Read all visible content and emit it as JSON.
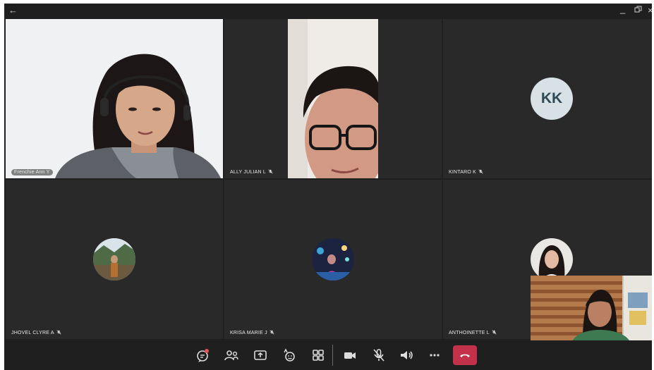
{
  "window": {
    "back_icon": "arrow-left-icon",
    "minimize_icon": "minimize-icon",
    "popout_icon": "popout-icon",
    "close_icon": "close-icon"
  },
  "participants": [
    {
      "name": "Frenchie Ann Y",
      "video": true
    },
    {
      "name": "ALLY JULIAN L",
      "muted": true,
      "video": true
    },
    {
      "name": "KINTARO K",
      "muted": true,
      "initials": "KK"
    },
    {
      "name": "JHOVEL CLYRE A",
      "muted": true,
      "avatar": "photo"
    },
    {
      "name": "KRISA MARIE J",
      "muted": true,
      "avatar": "photo"
    },
    {
      "name": "ANTHOINETTE L",
      "muted": true,
      "avatar": "photo"
    }
  ],
  "controls": [
    {
      "name": "chat-button",
      "icon": "chat-icon"
    },
    {
      "name": "participants-button",
      "icon": "people-icon"
    },
    {
      "name": "share-button",
      "icon": "share-screen-icon"
    },
    {
      "name": "reactions-button",
      "icon": "reaction-icon"
    },
    {
      "name": "apps-button",
      "icon": "grid-icon"
    },
    {
      "name": "camera-button",
      "icon": "camera-icon"
    },
    {
      "name": "mic-button",
      "icon": "mic-off-icon"
    },
    {
      "name": "speaker-button",
      "icon": "speaker-icon"
    },
    {
      "name": "more-button",
      "icon": "more-icon"
    },
    {
      "name": "leave-button",
      "icon": "hang-up-icon"
    }
  ],
  "colors": {
    "background": "#1f1f1f",
    "tile": "#292929",
    "leave": "#c4314b",
    "initials_avatar": "#d8e2e6",
    "initials_text": "#2e4a57"
  }
}
